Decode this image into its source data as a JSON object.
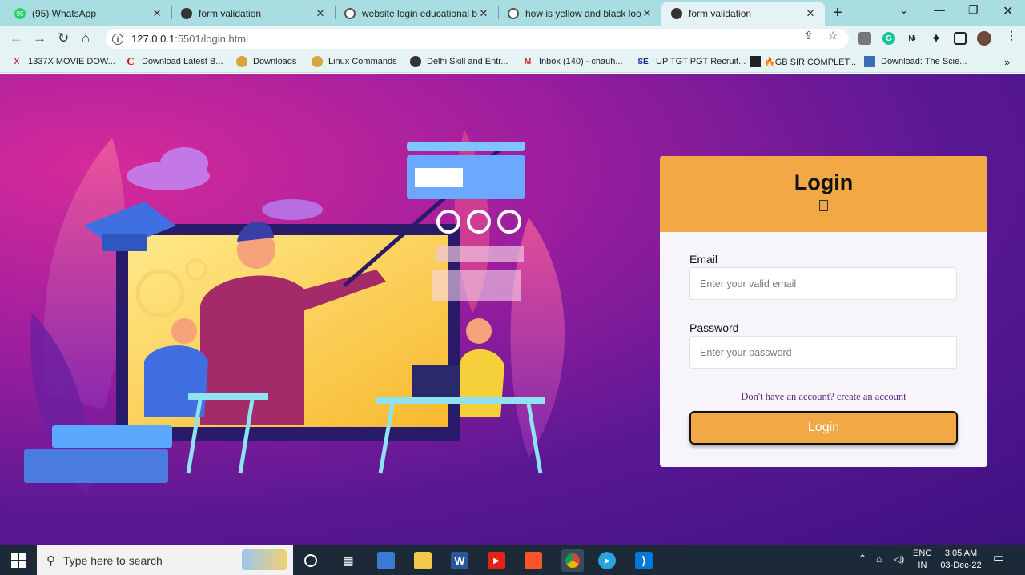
{
  "tabs": [
    {
      "title": "(95) WhatsApp",
      "icon": "whatsapp-icon",
      "badge": "95"
    },
    {
      "title": "form validation",
      "icon": "globe-icon"
    },
    {
      "title": "website login educational ba",
      "icon": "google-icon"
    },
    {
      "title": "how is yellow and black look",
      "icon": "google-icon"
    },
    {
      "title": "form validation",
      "icon": "globe-icon",
      "active": true
    }
  ],
  "address": {
    "host": "127.0.0.1",
    "path": ":5501/login.html"
  },
  "bookmarks": [
    {
      "label": "1337X MOVIE DOW...",
      "icon": "x-icon"
    },
    {
      "label": "Download Latest B...",
      "icon": "c-icon"
    },
    {
      "label": "Downloads",
      "icon": "disc-icon"
    },
    {
      "label": "Linux Commands",
      "icon": "disc-icon"
    },
    {
      "label": "Delhi Skill and Entr...",
      "icon": "globe-icon"
    },
    {
      "label": "Inbox (140) - chauh...",
      "icon": "gmail-icon"
    },
    {
      "label": "UP TGT PGT Recruit...",
      "icon": "se-icon"
    },
    {
      "label": "🔥GB SIR COMPLET...",
      "icon": "app-icon"
    },
    {
      "label": "Download: The Scie...",
      "icon": "doc-icon"
    }
  ],
  "extensions": {
    "n": "N",
    "n_sup": "i"
  },
  "login": {
    "title": "Login",
    "email_label": "Email",
    "email_placeholder": "Enter your valid email",
    "password_label": "Password",
    "password_placeholder": "Enter your password",
    "register_link": "Don't have an account? create an account",
    "submit_label": "Login"
  },
  "taskbar": {
    "search_placeholder": "Type here to search",
    "lang_top": "ENG",
    "lang_bottom": "IN",
    "time": "3:05 AM",
    "date": "03-Dec-22"
  },
  "colors": {
    "accent": "#f2a945",
    "tab_strip": "#a8dde2",
    "page_bg": "#5a1894"
  }
}
